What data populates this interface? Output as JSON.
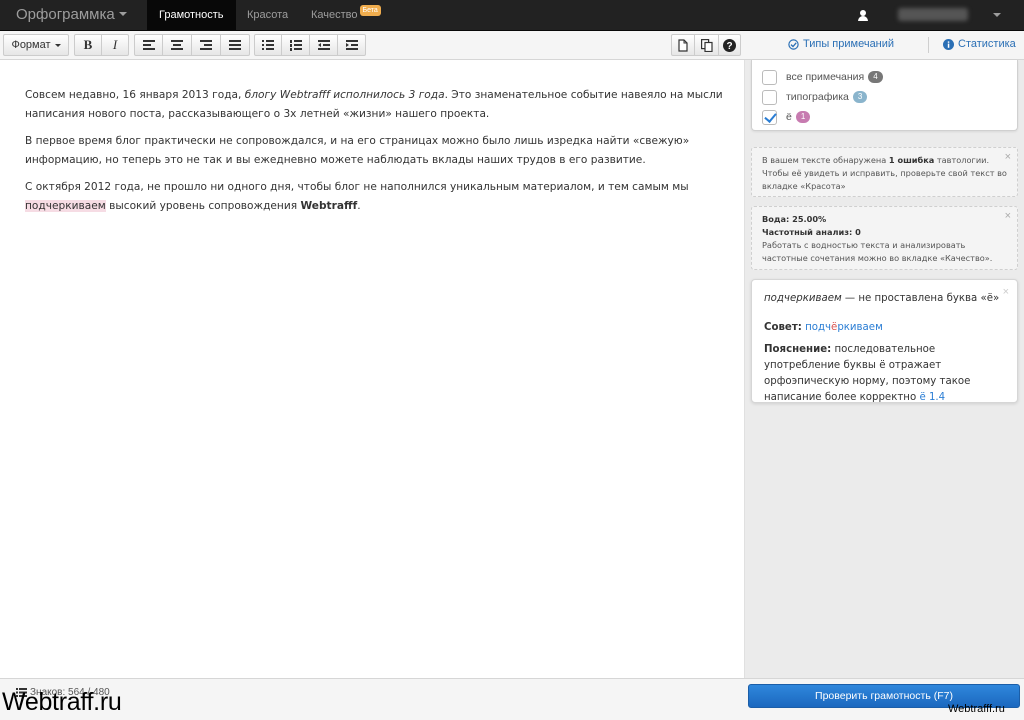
{
  "app": {
    "title": "Орфограммка",
    "tabs": [
      {
        "label": "Грамотность",
        "active": true
      },
      {
        "label": "Красота",
        "active": false
      },
      {
        "label": "Качество",
        "active": false,
        "badge": "Бета"
      }
    ]
  },
  "toolbar": {
    "format_label": "Формат",
    "bold_label": "B",
    "italic_label": "I"
  },
  "side_header": {
    "note_types": "Типы примечаний",
    "statistics": "Статистика"
  },
  "editor": {
    "p1_a": "Совсем недавно, 16 января 2013 года, ",
    "p1_em": "блогу Webtrafff исполнилось 3 года",
    "p1_b": ". Это знаменательное событие навеяло на мысли написания нового поста, рассказывающего о 3х летней «жизни» нашего проекта.",
    "p2": "В первое время блог практически не сопровождался, и на его страницах можно было лишь изредка найти «свежую» информацию, но теперь это не так и вы ежедневно можете наблюдать вклады наших трудов в его развитие.",
    "p3_a": "С октября 2012 года, не прошло ни одного дня, чтобы блог не наполнился уникальным материалом, и тем самым мы ",
    "p3_highlight": "подчеркиваем",
    "p3_b": " высокий уровень сопровождения ",
    "p3_bold": "Webtrafff",
    "p3_c": "."
  },
  "filters": [
    {
      "label": "все примечания",
      "count": "4",
      "checked": false,
      "color": "#777777"
    },
    {
      "label": "типографика",
      "count": "3",
      "checked": false,
      "color": "#8ab4cc"
    },
    {
      "label": "ё",
      "count": "1",
      "checked": true,
      "color": "#c77bb0"
    }
  ],
  "notices": {
    "tautology_a": "В вашем тексте обнаружена ",
    "tautology_bold": "1 ошибка",
    "tautology_b": " тавтологии. Чтобы её увидеть и исправить, проверьте свой текст во вкладке «Красота»",
    "water": "Вода: 25.00%",
    "freq": "Частотный анализ: 0",
    "quality_text": "Работать с водностью текста и анализировать частотные сочетания можно во вкладке «Качество».",
    "close": "×"
  },
  "card": {
    "word": "подчеркиваем",
    "issue": " — не проставлена буква «ё»",
    "advice_label": "Совет:",
    "advice_a": "подч",
    "advice_letter": "ё",
    "advice_b": "ркиваем",
    "explain_label": "Пояснение:",
    "explain_text": " последовательное употребление буквы ё отражает орфоэпическую норму, поэтому такое написание более корректно ",
    "rule_link": "ё 1.4",
    "close": "×"
  },
  "footer": {
    "chars": "Знаков: 564 / 480",
    "check_button": "Проверить грамотность (F7)"
  },
  "watermark": {
    "left": "Webtraff.ru",
    "right": "Webtrafff.ru"
  },
  "colors": {
    "navbar": "#222222",
    "accent": "#2a7dd4",
    "highlight": "#f6dce4"
  }
}
